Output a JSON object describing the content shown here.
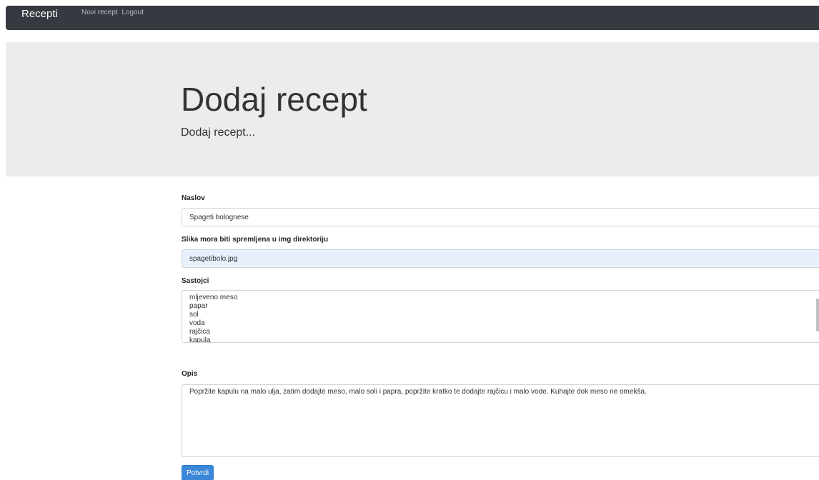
{
  "navbar": {
    "brand": "Recepti",
    "links": [
      "Novi recept",
      "Logout"
    ]
  },
  "jumbotron": {
    "title": "Dodaj recept",
    "subtitle": "Dodaj recept..."
  },
  "form": {
    "naslov": {
      "label": "Naslov",
      "value": "Spageti bolognese"
    },
    "slika": {
      "label": "Slika mora biti spremljena u img direktoriju",
      "value": "spagetibolo.jpg"
    },
    "sastojci": {
      "label": "Sastojci",
      "value": "mljeveno meso\npapar\nsol\nvoda\nrajčica\nkapula\nulje"
    },
    "opis": {
      "label": "Opis",
      "value": "Popržite kapulu na malo ulja, zatim dodajte meso, malo soli i papra, popržite kratko te dodajte rajčicu i malo vode. Kuhajte dok meso ne omekša."
    },
    "submit_label": "Potvrdi"
  },
  "colors": {
    "navbar": "#343a40",
    "jumbotron": "#ececec",
    "button": "#3b88d8",
    "autofill": "#e8f0fe"
  }
}
